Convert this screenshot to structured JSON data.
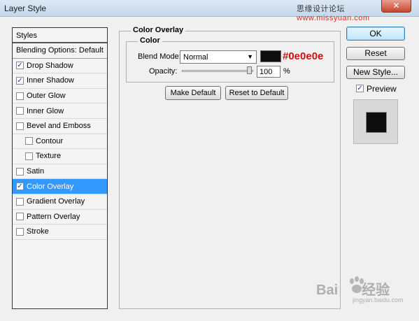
{
  "window": {
    "title": "Layer Style",
    "close_glyph": "✕",
    "watermark_prefix": "思缘设计论坛",
    "watermark_site": "www.missyuan.com"
  },
  "styles_panel": {
    "header": "Styles",
    "blending_options": "Blending Options: Default",
    "items": [
      {
        "label": "Drop Shadow",
        "checked": true
      },
      {
        "label": "Inner Shadow",
        "checked": true
      },
      {
        "label": "Outer Glow",
        "checked": false
      },
      {
        "label": "Inner Glow",
        "checked": false
      },
      {
        "label": "Bevel and Emboss",
        "checked": false
      },
      {
        "label": "Contour",
        "checked": false,
        "indent": true
      },
      {
        "label": "Texture",
        "checked": false,
        "indent": true
      },
      {
        "label": "Satin",
        "checked": false
      },
      {
        "label": "Color Overlay",
        "checked": true,
        "selected": true
      },
      {
        "label": "Gradient Overlay",
        "checked": false
      },
      {
        "label": "Pattern Overlay",
        "checked": false
      },
      {
        "label": "Stroke",
        "checked": false
      }
    ],
    "check_glyph": "✓"
  },
  "color_overlay": {
    "group_title": "Color Overlay",
    "subgroup_title": "Color",
    "blend_mode_label": "Blend Mode:",
    "blend_mode_value": "Normal",
    "dropdown_arrow": "▼",
    "swatch_color": "#0e0e0e",
    "swatch_hex_label": "#0e0e0e",
    "opacity_label": "Opacity:",
    "opacity_value": "100",
    "opacity_unit": "%",
    "opacity_fraction": 1.0,
    "make_default": "Make Default",
    "reset_to_default": "Reset to Default"
  },
  "actions": {
    "ok": "OK",
    "reset": "Reset",
    "new_style": "New Style...",
    "preview_label": "Preview",
    "preview_checked": true
  },
  "watermark": {
    "brand": "Bai",
    "brand_suffix": "经验",
    "site": "jingyan.baidu.com"
  },
  "colors": {
    "selection": "#3399ff",
    "hex_annotation": "#d01010",
    "accent_border": "#3c7fb1"
  }
}
